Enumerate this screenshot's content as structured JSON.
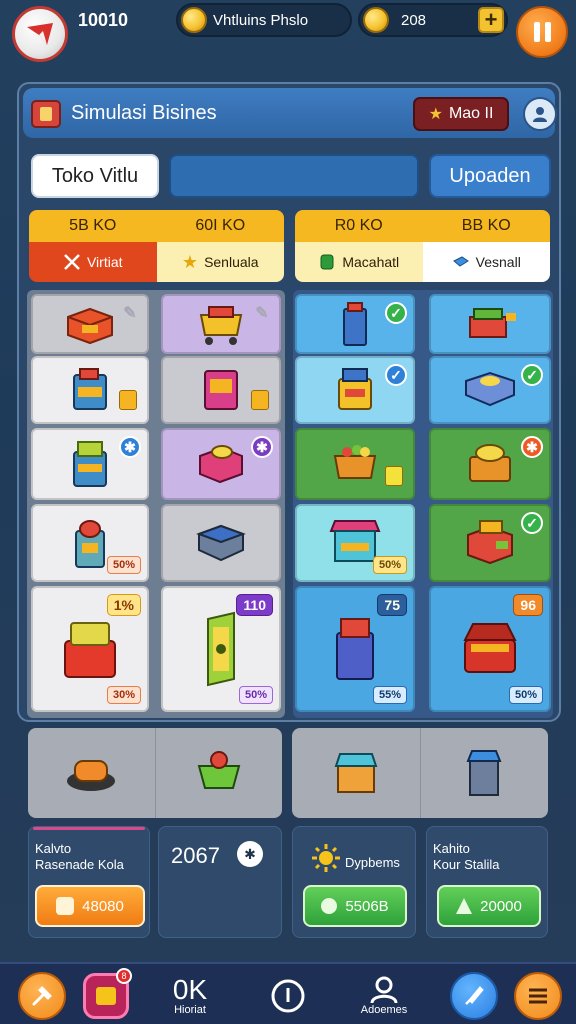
{
  "top": {
    "score": "10010",
    "pill1_text": "Vhtluins Phslo",
    "pill2_value": "208",
    "plus_label": "+"
  },
  "panel": {
    "title": "Simulasi Bisines",
    "mode_badge": "Mao II",
    "tab_shop": "Toko Vitlu",
    "search_value": "",
    "tab_upgrade": "Upoaden"
  },
  "sections": {
    "left": {
      "top_labels": [
        "5B KO",
        "60I KO"
      ],
      "bottom_labels": [
        "Virtiat",
        "Senluala"
      ]
    },
    "right": {
      "top_labels": [
        "R0 KO",
        "BB KO"
      ],
      "bottom_labels": [
        "Macahatl",
        "Vesnall"
      ]
    }
  },
  "tags": {
    "c1_3": "50%",
    "c1_4_corner": "1%",
    "c1_4_tag": "30%",
    "c2_4_corner": "110",
    "c2_4_tag": "50%",
    "c3_3_tag": "50%",
    "c3_4_corner": "75",
    "c3_4_tag": "55%",
    "c4_4_corner": "96",
    "c4_4_tag": "50%"
  },
  "stats": {
    "card1_label": "Kalvto\nRasenade Kola",
    "card1_button": "48080",
    "card2_value": "2067",
    "card3_label": "Dypbems",
    "card3_button": "5506B",
    "card4_label": "Kahito\nKour Stalila",
    "card4_button": "20000"
  },
  "nav": {
    "item3_glyph": "0K",
    "item3_label": "Hioriat",
    "item5_label": "Adoemes",
    "badge": "8"
  },
  "colors": {
    "accent_orange": "#f07c1a",
    "panel_blue": "#2f66a5",
    "section_yellow": "#f6b821",
    "nav_bg": "#1e2f55"
  },
  "icons": {
    "logo": "brand-logo-icon",
    "pause": "pause-icon",
    "user": "user-icon",
    "coin": "coin-icon"
  }
}
